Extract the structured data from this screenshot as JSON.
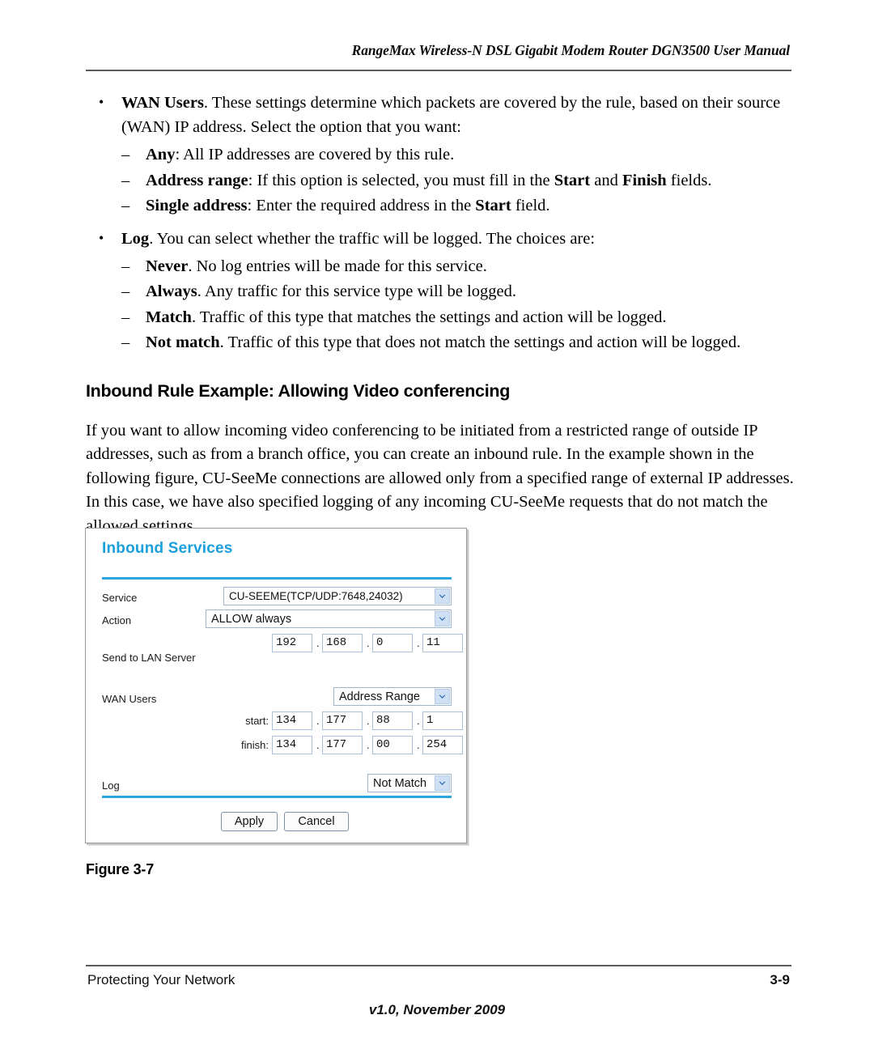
{
  "header": {
    "running_title": "RangeMax Wireless-N DSL Gigabit Modem Router DGN3500 User Manual"
  },
  "body": {
    "bullets": [
      {
        "lead": "WAN Users",
        "text": ". These settings determine which packets are covered by the rule, based on their source (WAN) IP address. Select the option that you want:",
        "sub": [
          {
            "lead": "Any",
            "text": ": All IP addresses are covered by this rule."
          },
          {
            "lead": "Address range",
            "text": ": If this option is selected, you must fill in the Start and Finish fields."
          },
          {
            "lead": "Single address",
            "text": ": Enter the required address in the Start field."
          }
        ]
      },
      {
        "lead": "Log",
        "text": ". You can select whether the traffic will be logged. The choices are:",
        "sub": [
          {
            "lead": "Never",
            "text": ". No log entries will be made for this service."
          },
          {
            "lead": "Always",
            "text": ". Any traffic for this service type will be logged."
          },
          {
            "lead": "Match",
            "text": ". Traffic of this type that matches the settings and action will be logged."
          },
          {
            "lead": "Not match",
            "text": ". Traffic of this type that does not match the settings and action will be logged."
          }
        ]
      }
    ],
    "bullet_marker": "•",
    "dash_marker": "–",
    "section_heading": "Inbound Rule Example: Allowing Video conferencing",
    "paragraph": "If you want to allow incoming video conferencing to be initiated from a restricted range of outside IP addresses, such as from a branch office, you can create an inbound rule. In the example shown in the following figure, CU-SeeMe connections are allowed only from a specified range of external IP addresses. In this case, we have also specified logging of any incoming CU-SeeMe requests that do not match the allowed settings."
  },
  "figure": {
    "caption": "Figure 3-7",
    "panel": {
      "title": "Inbound Services",
      "accent_color": "#2ba6e0",
      "fields": {
        "service_label": "Service",
        "service_value": "CU-SEEME(TCP/UDP:7648,24032)",
        "action_label": "Action",
        "action_value": "ALLOW always",
        "lan_server_label": "Send to LAN Server",
        "lan_server_ip": [
          "192",
          "168",
          "0",
          "11"
        ],
        "wan_users_label": "WAN Users",
        "wan_users_value": "Address Range",
        "start_label": "start:",
        "start_ip": [
          "134",
          "177",
          "88",
          "1"
        ],
        "finish_label": "finish:",
        "finish_ip": [
          "134",
          "177",
          "00",
          "254"
        ],
        "log_label": "Log",
        "log_value": "Not Match"
      },
      "buttons": {
        "apply": "Apply",
        "cancel": "Cancel"
      },
      "separator": "."
    }
  },
  "footer": {
    "left": "Protecting Your Network",
    "right": "3-9",
    "center": "v1.0, November 2009"
  }
}
